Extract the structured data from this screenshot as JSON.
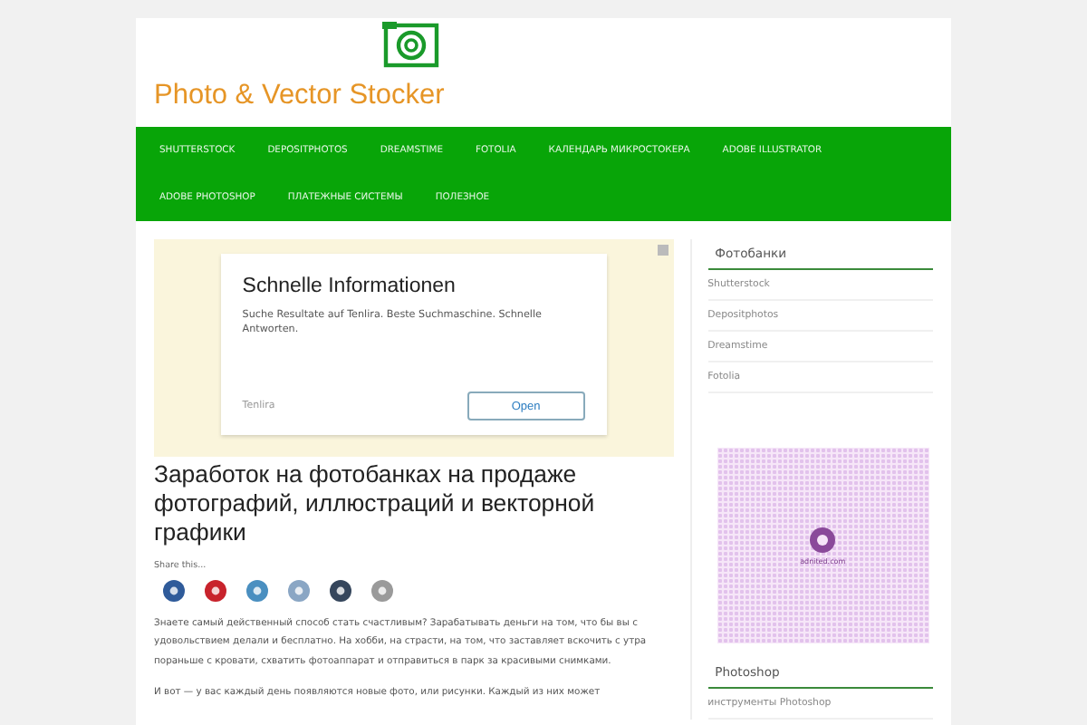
{
  "logo": {
    "text": "Photo & Vector Stocker"
  },
  "nav": {
    "items": [
      {
        "label": "SHUTTERSTOCK"
      },
      {
        "label": "DEPOSITPHOTOS"
      },
      {
        "label": "DREAMSTIME"
      },
      {
        "label": "FOTOLIA"
      },
      {
        "label": "КАЛЕНДАРЬ МИКРОСТОКЕРА"
      },
      {
        "label": "ADOBE ILLUSTRATOR"
      },
      {
        "label": "ADOBE PHOTOSHOP"
      },
      {
        "label": "ПЛАТЕЖНЫЕ СИСТЕМЫ"
      },
      {
        "label": "ПОЛЕЗНОЕ"
      }
    ]
  },
  "ad": {
    "title": "Schnelle Informationen",
    "text": "Suche Resultate auf Tenlira. Beste Suchmaschine. Schnelle Antworten.",
    "advertiser": "Tenlira",
    "button": "Open"
  },
  "article": {
    "title": "Заработок на фотобанках на продаже фотографий, иллюстраций и векторной графики",
    "share_label": "Share this...",
    "share": [
      {
        "color": "#2f5b9a"
      },
      {
        "color": "#c8232c"
      },
      {
        "color": "#4a8fc0"
      },
      {
        "color": "#8aa6c4"
      },
      {
        "color": "#35465c"
      },
      {
        "color": "#9a9a9a"
      }
    ],
    "paragraphs": [
      "Знаете самый действенный способ стать счастливым? Зарабатывать деньги на том, что бы вы с удовольствием делали и бесплатно. На хобби, на страсти, на том, что заставляет вскочить с утра пораньше с кровати, схватить фотоаппарат и отправиться в парк за красивыми снимками.",
      "И вот — у вас каждый день появляются новые фото, или рисунки. Каждый из них может"
    ]
  },
  "sidebar": {
    "widgets": [
      {
        "title": "Фотобанки",
        "items": [
          "Shutterstock",
          "Depositphotos",
          "Dreamstime",
          "Fotolia"
        ]
      }
    ],
    "ad_site": "adnited.com",
    "widgets_2": [
      {
        "title": "Photoshop",
        "items": [
          "инструменты Photoshop"
        ]
      }
    ]
  }
}
